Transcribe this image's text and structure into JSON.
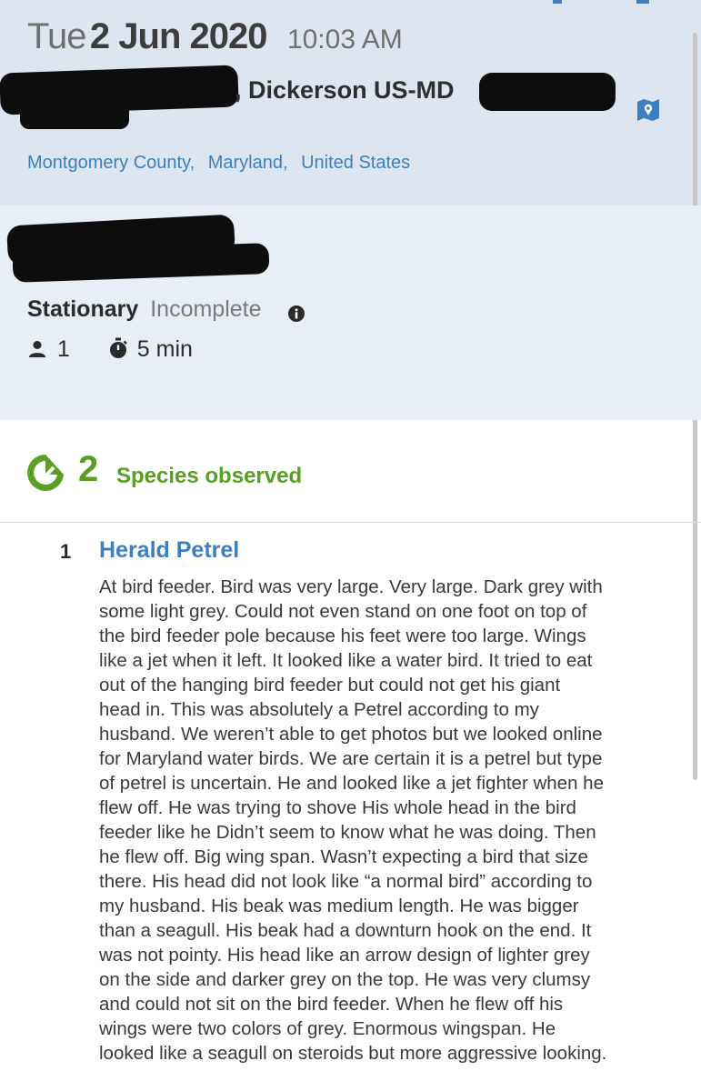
{
  "checklist": {
    "date": {
      "day_of_week": "Tue",
      "date": "2 Jun 2020",
      "time": "10:03 AM"
    },
    "location": {
      "name": ", Dickerson US-MD",
      "region": [
        "Montgomery County,",
        "Maryland,",
        "United States"
      ],
      "map_icon": "map-pin-icon"
    },
    "protocol": {
      "type": "Stationary",
      "status": "Incomplete",
      "info_icon": "info-icon"
    },
    "stats": {
      "observers": "1",
      "duration": "5 min"
    },
    "species_summary": {
      "count": "2",
      "label": "Species observed",
      "icon": "check-arrow-icon"
    },
    "entries": [
      {
        "count": "1",
        "species": "Herald Petrel",
        "comment": "At bird feeder. Bird was very large. Very large. Dark grey with\nsome light grey. Could not even stand on one foot on top of\nthe bird feeder pole because his feet were too large. Wings\nlike a jet when it left. It looked like a water bird. It tried to eat\nout of the hanging bird feeder but could not get his giant\nhead in. This was absolutely a Petrel according to my\nhusband. We weren’t able to get photos but we looked online\nfor Maryland water birds. We are certain it is a petrel but type\nof petrel is uncertain. He and looked like a jet fighter when he\nflew off. He was trying to shove His whole head in the bird\nfeeder like he Didn’t seem to know what he was doing. Then\nhe flew off. Big wing span. Wasn’t expecting a bird that size\nthere. His head did not look like “a normal bird” according to\nmy husband. His beak was medium length. He was bigger\nthan a seagull. His beak had a downturn hook on the end. It\nwas not pointy. His head like an arrow design of lighter grey\non the side and darker grey on the top. He was very clumsy\nand could not sit on the bird feeder. When he flew off his\nwings were two colors of grey. Enormous wingspan. He\nlooked like a seagull on steroids but more aggressive looking."
      }
    ]
  },
  "colors": {
    "header_bg": "#dde6f0",
    "info_bg": "#e8eef6",
    "link_blue": "#3d7fbf",
    "species_green": "#5a9e23"
  }
}
